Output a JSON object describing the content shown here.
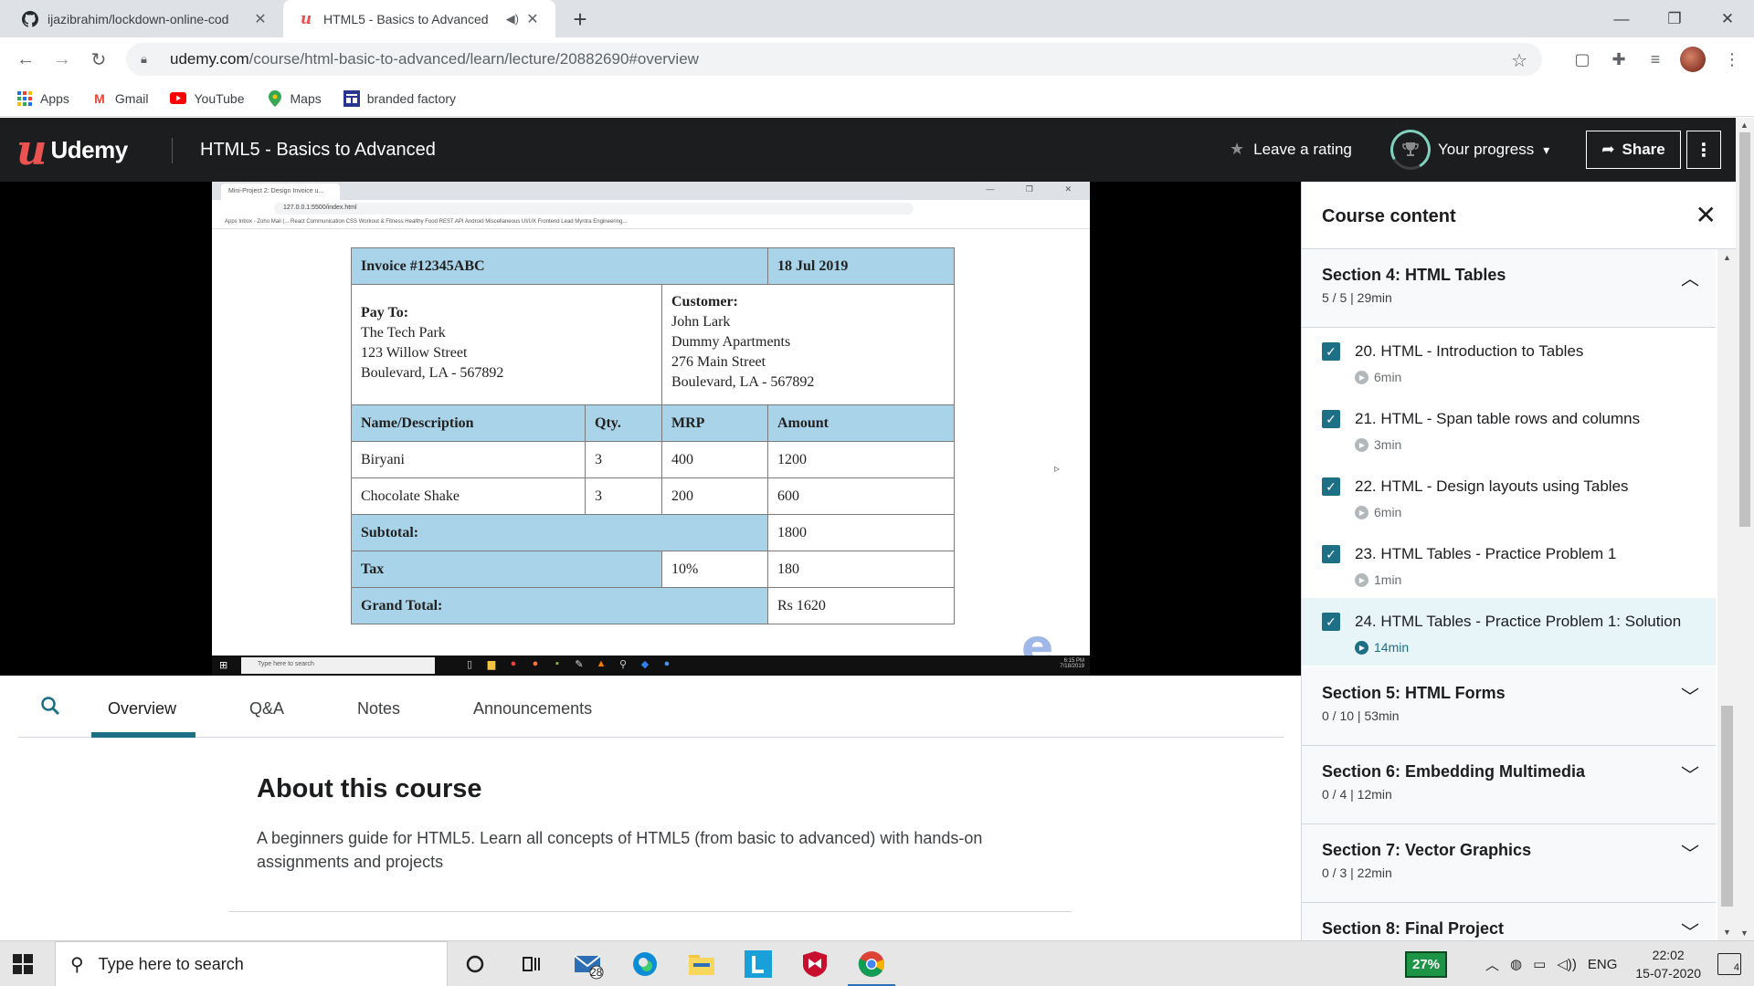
{
  "browser": {
    "tabs": [
      {
        "title": "ijazibrahim/lockdown-online-cod",
        "icon": "github-icon",
        "active": false
      },
      {
        "title": "HTML5 - Basics to Advanced",
        "icon": "udemy-icon",
        "active": true
      }
    ],
    "new_tab": "+",
    "url_host": "udemy.com",
    "url_path": "/course/html-basic-to-advanced/learn/lecture/20882690#overview",
    "bookmarks": [
      {
        "label": "Apps",
        "icon": "apps-grid-icon"
      },
      {
        "label": "Gmail",
        "icon": "gmail-icon"
      },
      {
        "label": "YouTube",
        "icon": "youtube-icon"
      },
      {
        "label": "Maps",
        "icon": "maps-pin-icon"
      },
      {
        "label": "branded factory",
        "icon": "bookmark-site-icon"
      }
    ]
  },
  "header": {
    "brand": "Udemy",
    "course_title": "HTML5 - Basics to Advanced",
    "leave_rating": "Leave a rating",
    "your_progress": "Your progress",
    "share": "Share"
  },
  "video": {
    "inner_tab": "Mini-Project 2: Design Invoice u...",
    "inner_url": "127.0.0.1:5500/index.html",
    "inner_bookmarks": "Apps   Inbox - Zoho Mail (...   React   Communication   CSS   Workout & Fitness   Healthy Food   REST API   Android   Miscellaneous   UI/UX   Frontend Lead   Myntra Engineering...",
    "inner_search": "Type here to search",
    "inner_time": "6:15 PM",
    "inner_date": "7/18/2019",
    "invoice": {
      "number": "Invoice #12345ABC",
      "date": "18 Jul 2019",
      "pay_to_label": "Pay To:",
      "pay_to_lines": [
        "The Tech Park",
        "123 Willow Street",
        "Boulevard, LA - 567892"
      ],
      "customer_label": "Customer:",
      "customer_lines": [
        "John Lark",
        "Dummy Apartments",
        "276 Main Street",
        "Boulevard, LA - 567892"
      ],
      "col_name": "Name/Description",
      "col_qty": "Qty.",
      "col_mrp": "MRP",
      "col_amount": "Amount",
      "rows": [
        {
          "name": "Biryani",
          "qty": "3",
          "mrp": "400",
          "amount": "1200"
        },
        {
          "name": "Chocolate Shake",
          "qty": "3",
          "mrp": "200",
          "amount": "600"
        }
      ],
      "subtotal_label": "Subtotal:",
      "subtotal": "1800",
      "tax_label": "Tax",
      "tax_rate": "10%",
      "tax": "180",
      "grand_total_label": "Grand Total:",
      "grand_total": "Rs 1620"
    }
  },
  "lecture_tabs": [
    "Overview",
    "Q&A",
    "Notes",
    "Announcements"
  ],
  "about": {
    "heading": "About this course",
    "description": "A beginners guide for HTML5. Learn all concepts of HTML5 (from basic to advanced) with hands-on assignments and projects"
  },
  "sidebar": {
    "title": "Course content",
    "sections": [
      {
        "title": "Section 4: HTML Tables",
        "meta": "5 / 5 | 29min",
        "expanded": true
      },
      {
        "title": "Section 5: HTML Forms",
        "meta": "0 / 10 | 53min",
        "expanded": false
      },
      {
        "title": "Section 6: Embedding Multimedia",
        "meta": "0 / 4 | 12min",
        "expanded": false
      },
      {
        "title": "Section 7: Vector Graphics",
        "meta": "0 / 3 | 22min",
        "expanded": false
      },
      {
        "title": "Section 8: Final Project",
        "meta": "",
        "expanded": false
      }
    ],
    "items": [
      {
        "title": "20. HTML - Introduction to Tables",
        "duration": "6min",
        "done": true
      },
      {
        "title": "21. HTML - Span table rows and columns",
        "duration": "3min",
        "done": true
      },
      {
        "title": "22. HTML - Design layouts using Tables",
        "duration": "6min",
        "done": true
      },
      {
        "title": "23. HTML Tables - Practice Problem 1",
        "duration": "1min",
        "done": true
      },
      {
        "title": "24. HTML Tables - Practice Problem 1: Solution",
        "duration": "14min",
        "done": true,
        "current": true
      }
    ]
  },
  "taskbar": {
    "search_placeholder": "Type here to search",
    "mail_badge": "28",
    "battery": "27%",
    "language": "ENG",
    "time": "22:02",
    "date": "15-07-2020",
    "notifications": "4"
  },
  "colors": {
    "udemy_red": "#ec5252",
    "udemy_dark": "#1c1d1f",
    "teal": "#1c6f84",
    "invoice_header": "#a8d3e8"
  }
}
